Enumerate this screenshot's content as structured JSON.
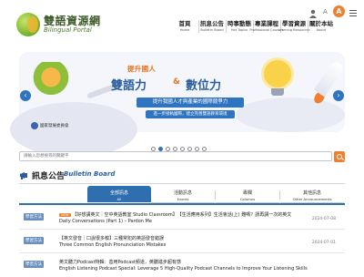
{
  "site": {
    "title": "雙語資源網",
    "subtitle": "Bilingual Portal"
  },
  "nav": [
    {
      "zh": "首頁",
      "en": "Home"
    },
    {
      "zh": "訊息公告",
      "en": "Bulletin Board"
    },
    {
      "zh": "時事動態",
      "en": "Hot Topics"
    },
    {
      "zh": "專業課程",
      "en": "Professional Courses"
    },
    {
      "zh": "學習資源",
      "en": "Learning Resources"
    },
    {
      "zh": "關於本站",
      "en": "About"
    }
  ],
  "toolbar": {
    "font_size_small": "A",
    "font_size_large": "A"
  },
  "banner": {
    "headline_1": "提升國人",
    "headline_2a": "雙語力",
    "headline_amp": "&",
    "headline_2b": "數位力",
    "pill_1": "提升我國人才與產業的國際競爭力",
    "pill_2": "進一步接軌國際，建立完善雙語教育環境",
    "ministry": "國家發展委員會",
    "prev": "‹",
    "next": "›",
    "slide_count": 8,
    "active_slide": 1
  },
  "search": {
    "placeholder": "請輸入您想搜尋的關鍵字"
  },
  "bulletin": {
    "title": "訊息公告",
    "title_en": "Bulletin Board",
    "tabs": [
      {
        "zh": "全部訊息",
        "en": "All",
        "active": true
      },
      {
        "zh": "活動訊息",
        "en": "Events",
        "active": false
      },
      {
        "zh": "專欄",
        "en": "Columns",
        "active": false
      },
      {
        "zh": "其他訊息",
        "en": "Other Announcements",
        "active": false
      }
    ],
    "items": [
      {
        "badge": "學習方法",
        "new": "NEW",
        "line1": "【好想講英文｜空中英語教室 Studio Classroom】　【生活應用系列】生活會話(上) 難嗎？請再講一次的英文",
        "line2": "Daily Conversations (Part 1) – Pardon Me",
        "date": "2024-07-08"
      },
      {
        "badge": "學習方法",
        "line1": "【英文發音｜口說很多糗】三種常犯的英語發音錯誤",
        "line2": "Three Common English Pronunciation Mistakes",
        "date": "2024-07-01"
      },
      {
        "badge": "學習方法",
        "line1": "英文聽力Podcast特輯：善用Podcast頻道，英聽進步超有感",
        "line2": "English Listening Podcast Special: Leverage 5 High-Quality Podcast Channels to Improve Your Listening Skills",
        "date": ""
      }
    ]
  },
  "colors": {
    "accent_orange": "#f08030",
    "brand_blue": "#2f6fb0",
    "logo_green": "#6fae2a"
  }
}
